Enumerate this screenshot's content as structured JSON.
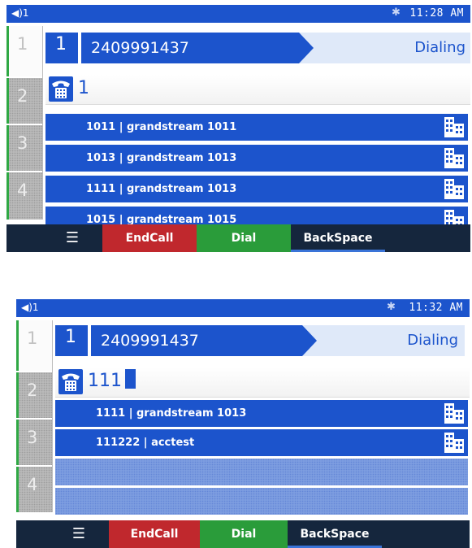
{
  "screens": [
    {
      "status_bar": {
        "volume": "◀)1",
        "bluetooth": "✱",
        "time": "11:28 AM"
      },
      "line_keys": [
        "1",
        "2",
        "3",
        "4"
      ],
      "active_call": {
        "line": "1",
        "number": "2409991437",
        "status": "Dialing"
      },
      "dial_input": "1",
      "results": [
        "1011 | grandstream 1011",
        "1013 | grandstream 1013",
        "1111 | grandstream 1013",
        "1015 | grandstream 1015"
      ],
      "softkeys": {
        "menu": "☰",
        "end_call": "EndCall",
        "dial": "Dial",
        "backspace": "BackSpace"
      }
    },
    {
      "status_bar": {
        "volume": "◀)1",
        "bluetooth": "✱",
        "time": "11:32 AM"
      },
      "line_keys": [
        "1",
        "2",
        "3",
        "4"
      ],
      "active_call": {
        "line": "1",
        "number": "2409991437",
        "status": "Dialing"
      },
      "dial_input": "111",
      "results": [
        "1111 | grandstream 1013",
        "111222 | acctest"
      ],
      "softkeys": {
        "menu": "☰",
        "end_call": "EndCall",
        "dial": "Dial",
        "backspace": "BackSpace"
      }
    }
  ],
  "colors": {
    "primary": "#1c54cc",
    "end_call": "#c0282d",
    "dial": "#2a9c3a",
    "softkey_bar": "#15263d"
  },
  "icons": {
    "phone": "phone-icon",
    "contact": "building-contact-icon",
    "menu": "menu-icon"
  }
}
